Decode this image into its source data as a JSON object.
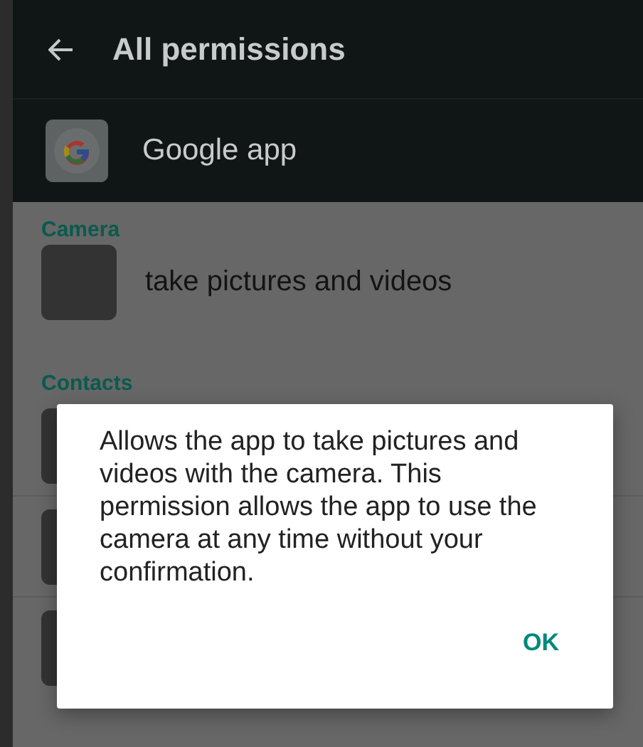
{
  "toolbar": {
    "title": "All permissions"
  },
  "app": {
    "name": "Google app"
  },
  "sections": [
    {
      "header": "Camera",
      "permissions": [
        {
          "label": "take pictures and videos"
        }
      ]
    },
    {
      "header": "Contacts"
    }
  ],
  "dialog": {
    "message": "Allows the app to take pictures and videos with the camera. This permission allows the app to use the camera at any time without your confirmation.",
    "buttons": [
      "OK"
    ]
  }
}
